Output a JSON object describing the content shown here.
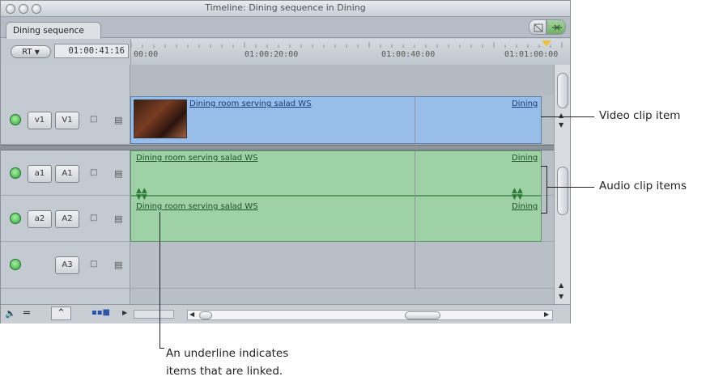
{
  "window": {
    "title": "Timeline: Dining sequence in Dining",
    "tab": "Dining sequence"
  },
  "header": {
    "rt_label": "RT",
    "timecode": "01:00:41:16",
    "ruler_ticks": [
      "00:00",
      "01:00:20:00",
      "01:00:40:00",
      "01:01:00:00"
    ]
  },
  "tracks": {
    "v1": {
      "source": "v1",
      "dest": "V1"
    },
    "a1": {
      "source": "a1",
      "dest": "A1"
    },
    "a2": {
      "source": "a2",
      "dest": "A2"
    },
    "a3": {
      "dest": "A3"
    }
  },
  "clips": {
    "video_name": "Dining room serving salad WS",
    "video_next": "Dining",
    "a1_name": "Dining room serving salad WS",
    "a1_next": "Dining",
    "a2_name": "Dining room serving salad WS",
    "a2_next": "Dining"
  },
  "annotations": {
    "video_clip": "Video clip item",
    "audio_clips": "Audio clip items",
    "underline_line1": "An underline indicates",
    "underline_line2": "items that are linked."
  },
  "icons": {
    "track_toggle": "green-circle",
    "lock": "padlock",
    "sync": "film-sync",
    "playhead": "yellow-triangle"
  },
  "colors": {
    "video_clip": "#98bde9",
    "audio_clip": "#9fd1a7",
    "playhead": "#e8c24a"
  }
}
